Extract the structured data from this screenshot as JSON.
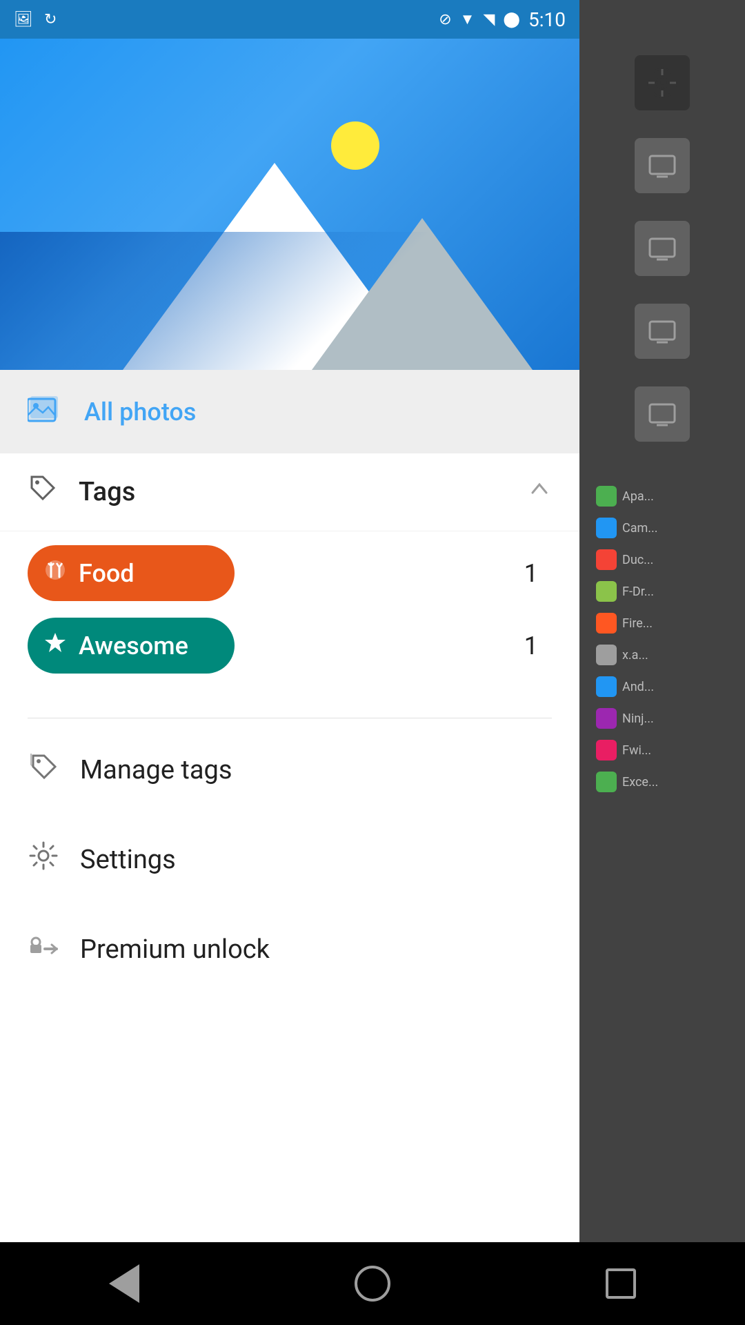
{
  "statusBar": {
    "time": "5:10",
    "icons": [
      "blocked",
      "wifi",
      "signal",
      "battery"
    ]
  },
  "hero": {
    "altText": "Mountain landscape"
  },
  "allPhotos": {
    "label": "All photos",
    "iconAlt": "photos-collection-icon"
  },
  "tags": {
    "sectionLabel": "Tags",
    "chevronAlt": "chevron-up",
    "items": [
      {
        "id": "food",
        "label": "Food",
        "count": "1",
        "colorClass": "food",
        "iconType": "utensils"
      },
      {
        "id": "awesome",
        "label": "Awesome",
        "count": "1",
        "colorClass": "awesome",
        "iconType": "star"
      }
    ]
  },
  "manageTags": {
    "label": "Manage tags"
  },
  "settings": {
    "label": "Settings"
  },
  "premiumUnlock": {
    "label": "Premium unlock"
  },
  "navBar": {
    "back": "Back",
    "home": "Home",
    "recent": "Recent apps"
  },
  "rightPanel": {
    "apps": [
      {
        "name": "Apa...",
        "color": "#4caf50"
      },
      {
        "name": "Cam...",
        "color": "#2196f3"
      },
      {
        "name": "Duc...",
        "color": "#f44336"
      },
      {
        "name": "F-Dr...",
        "color": "#8bc34a"
      },
      {
        "name": "Fire...",
        "color": "#ff5722"
      },
      {
        "name": "x.a...",
        "color": "#9e9e9e"
      },
      {
        "name": "And...",
        "color": "#2196f3"
      },
      {
        "name": "Ninj...",
        "color": "#9c27b0"
      },
      {
        "name": "Fwi...",
        "color": "#e91e63"
      },
      {
        "name": "Exce...",
        "color": "#4caf50"
      }
    ]
  }
}
